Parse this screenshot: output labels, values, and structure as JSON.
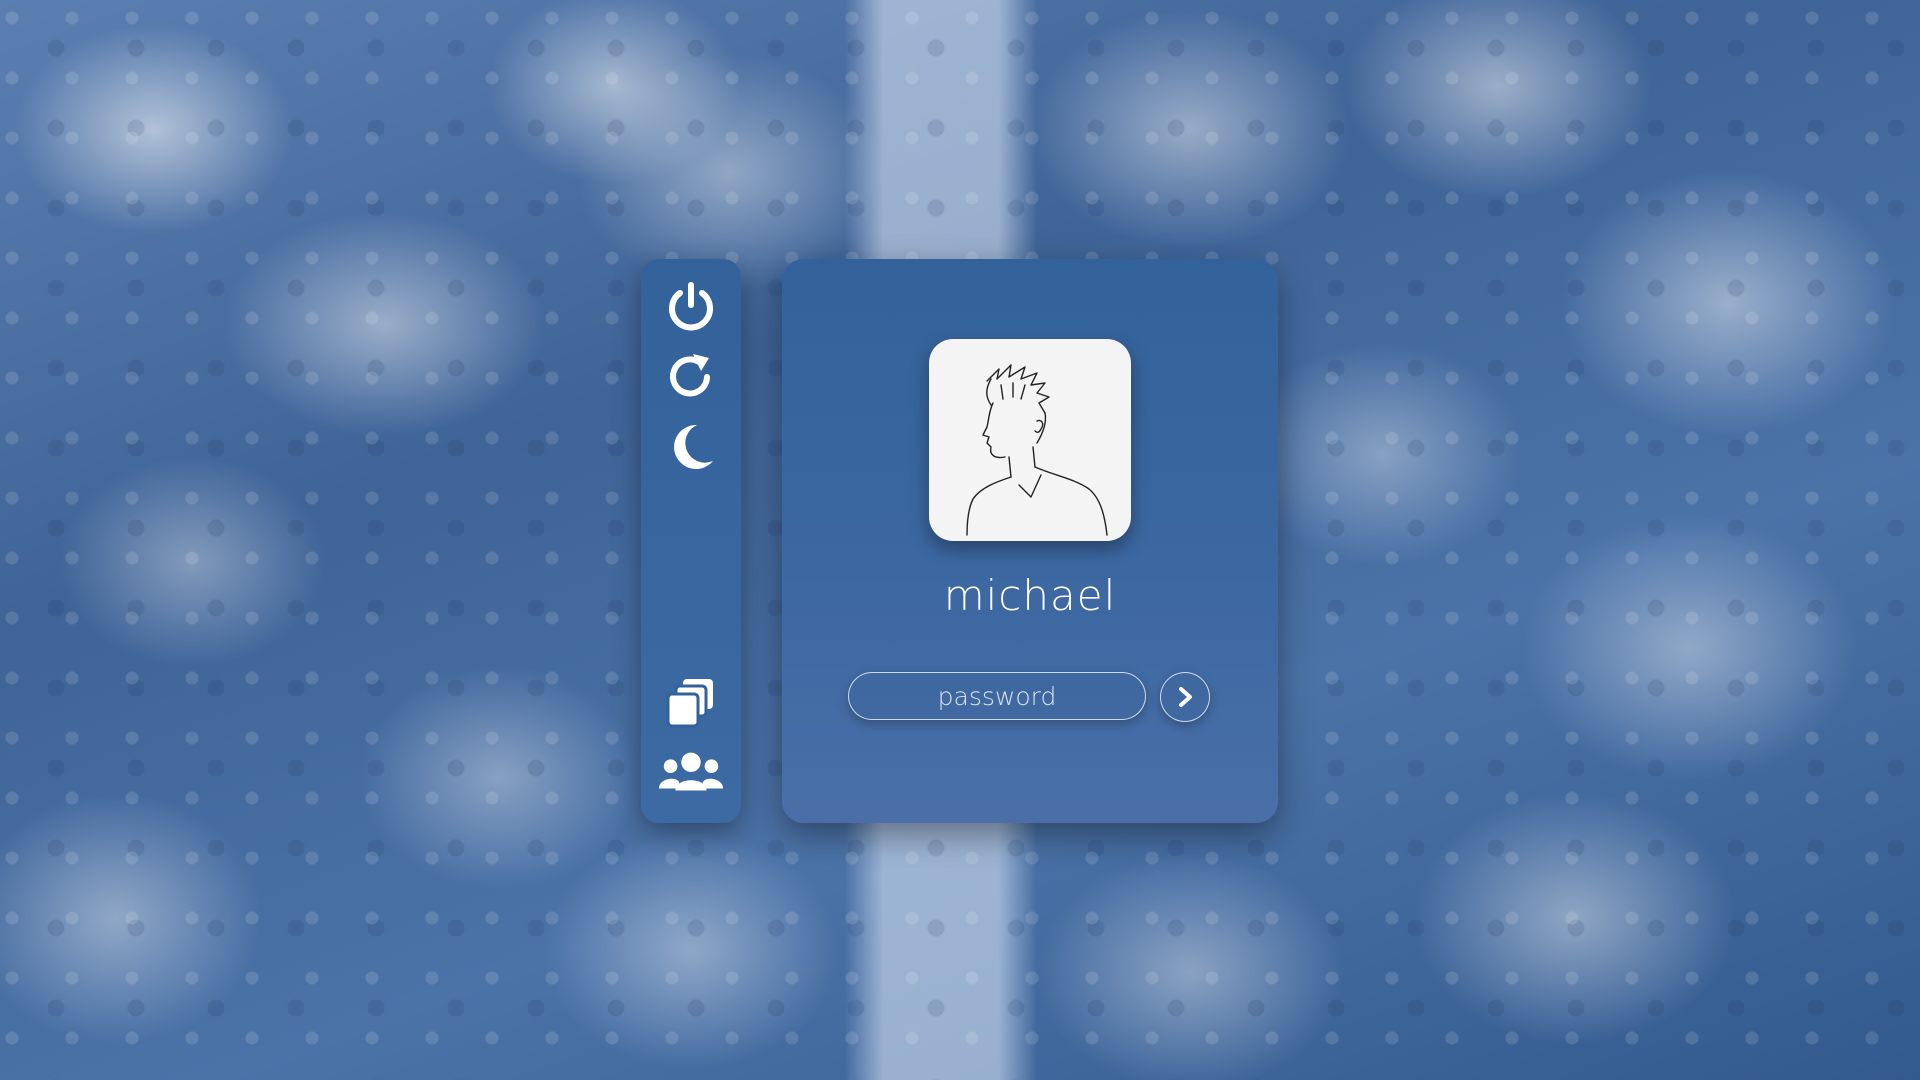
{
  "background": {
    "description_icon": "snowy-forest-wallpaper",
    "colors": {
      "primary": "#3f6497",
      "panel": "#33629a",
      "text": "#ffffff"
    }
  },
  "power_bar": {
    "top_icons": [
      "power-icon",
      "restart-icon",
      "sleep-icon"
    ],
    "bottom_icons": [
      "session-icon",
      "switch-user-icon"
    ]
  },
  "login": {
    "username": "michael",
    "password_placeholder": "password",
    "password_value": "",
    "submit_icon": "chevron-right-icon"
  }
}
